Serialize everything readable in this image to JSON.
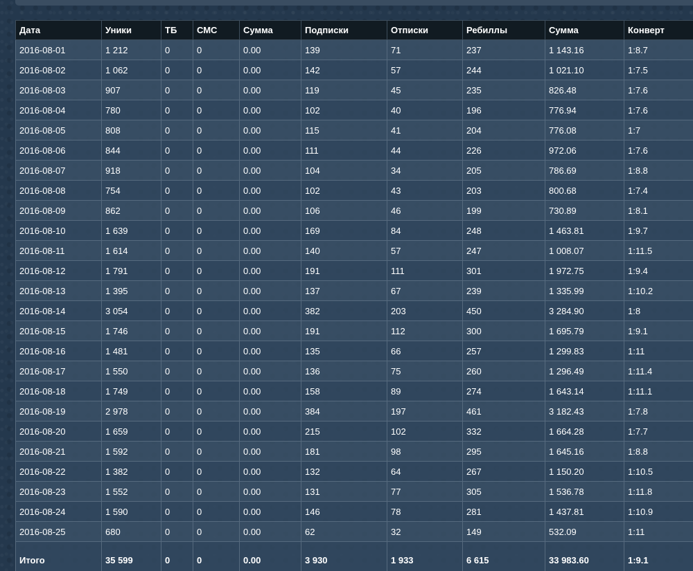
{
  "stats_table": {
    "headers": [
      "Дата",
      "Уники",
      "ТБ",
      "СМС",
      "Сумма",
      "Подписки",
      "Отписки",
      "Ребиллы",
      "Сумма",
      "Конверт"
    ],
    "rows": [
      [
        "2016-08-01",
        "1 212",
        "0",
        "0",
        "0.00",
        "139",
        "71",
        "237",
        "1 143.16",
        "1:8.7"
      ],
      [
        "2016-08-02",
        "1 062",
        "0",
        "0",
        "0.00",
        "142",
        "57",
        "244",
        "1 021.10",
        "1:7.5"
      ],
      [
        "2016-08-03",
        "907",
        "0",
        "0",
        "0.00",
        "119",
        "45",
        "235",
        "826.48",
        "1:7.6"
      ],
      [
        "2016-08-04",
        "780",
        "0",
        "0",
        "0.00",
        "102",
        "40",
        "196",
        "776.94",
        "1:7.6"
      ],
      [
        "2016-08-05",
        "808",
        "0",
        "0",
        "0.00",
        "115",
        "41",
        "204",
        "776.08",
        "1:7"
      ],
      [
        "2016-08-06",
        "844",
        "0",
        "0",
        "0.00",
        "111",
        "44",
        "226",
        "972.06",
        "1:7.6"
      ],
      [
        "2016-08-07",
        "918",
        "0",
        "0",
        "0.00",
        "104",
        "34",
        "205",
        "786.69",
        "1:8.8"
      ],
      [
        "2016-08-08",
        "754",
        "0",
        "0",
        "0.00",
        "102",
        "43",
        "203",
        "800.68",
        "1:7.4"
      ],
      [
        "2016-08-09",
        "862",
        "0",
        "0",
        "0.00",
        "106",
        "46",
        "199",
        "730.89",
        "1:8.1"
      ],
      [
        "2016-08-10",
        "1 639",
        "0",
        "0",
        "0.00",
        "169",
        "84",
        "248",
        "1 463.81",
        "1:9.7"
      ],
      [
        "2016-08-11",
        "1 614",
        "0",
        "0",
        "0.00",
        "140",
        "57",
        "247",
        "1 008.07",
        "1:11.5"
      ],
      [
        "2016-08-12",
        "1 791",
        "0",
        "0",
        "0.00",
        "191",
        "111",
        "301",
        "1 972.75",
        "1:9.4"
      ],
      [
        "2016-08-13",
        "1 395",
        "0",
        "0",
        "0.00",
        "137",
        "67",
        "239",
        "1 335.99",
        "1:10.2"
      ],
      [
        "2016-08-14",
        "3 054",
        "0",
        "0",
        "0.00",
        "382",
        "203",
        "450",
        "3 284.90",
        "1:8"
      ],
      [
        "2016-08-15",
        "1 746",
        "0",
        "0",
        "0.00",
        "191",
        "112",
        "300",
        "1 695.79",
        "1:9.1"
      ],
      [
        "2016-08-16",
        "1 481",
        "0",
        "0",
        "0.00",
        "135",
        "66",
        "257",
        "1 299.83",
        "1:11"
      ],
      [
        "2016-08-17",
        "1 550",
        "0",
        "0",
        "0.00",
        "136",
        "75",
        "260",
        "1 296.49",
        "1:11.4"
      ],
      [
        "2016-08-18",
        "1 749",
        "0",
        "0",
        "0.00",
        "158",
        "89",
        "274",
        "1 643.14",
        "1:11.1"
      ],
      [
        "2016-08-19",
        "2 978",
        "0",
        "0",
        "0.00",
        "384",
        "197",
        "461",
        "3 182.43",
        "1:7.8"
      ],
      [
        "2016-08-20",
        "1 659",
        "0",
        "0",
        "0.00",
        "215",
        "102",
        "332",
        "1 664.28",
        "1:7.7"
      ],
      [
        "2016-08-21",
        "1 592",
        "0",
        "0",
        "0.00",
        "181",
        "98",
        "295",
        "1 645.16",
        "1:8.8"
      ],
      [
        "2016-08-22",
        "1 382",
        "0",
        "0",
        "0.00",
        "132",
        "64",
        "267",
        "1 150.20",
        "1:10.5"
      ],
      [
        "2016-08-23",
        "1 552",
        "0",
        "0",
        "0.00",
        "131",
        "77",
        "305",
        "1 536.78",
        "1:11.8"
      ],
      [
        "2016-08-24",
        "1 590",
        "0",
        "0",
        "0.00",
        "146",
        "78",
        "281",
        "1 437.81",
        "1:10.9"
      ],
      [
        "2016-08-25",
        "680",
        "0",
        "0",
        "0.00",
        "62",
        "32",
        "149",
        "532.09",
        "1:11"
      ]
    ],
    "totals": [
      "Итого",
      "35 599",
      "0",
      "0",
      "0.00",
      "3 930",
      "1 933",
      "6 615",
      "33 983.60",
      "1:9.1"
    ]
  }
}
